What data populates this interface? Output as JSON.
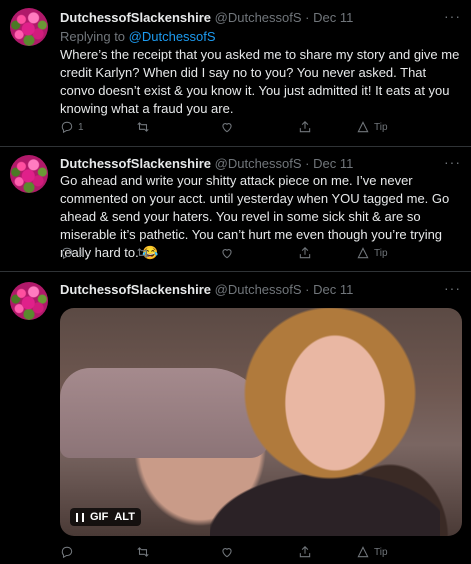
{
  "tweets": [
    {
      "name": "DutchessofSlackenshire",
      "handle": "@DutchessofS",
      "separator": "·",
      "date": "Dec 11",
      "reply_prefix": "Replying to",
      "reply_to": "@DutchessofS",
      "text": "Where’s the receipt that you asked me to share my story and give me credit Karlyn?  When did I say no to you?  You never asked.  That convo doesn’t exist & you know it.  You just admitted it!  It eats at you knowing what a fraud you are.",
      "reply_count": "1",
      "tip_label": "Tip"
    },
    {
      "name": "DutchessofSlackenshire",
      "handle": "@DutchessofS",
      "separator": "·",
      "date": "Dec 11",
      "text": "Go ahead and write your shitty attack piece on me.  I’ve never commented on your acct. until yesterday when YOU tagged me.  Go ahead & send your haters. You revel in some sick shit & are so miserable it’s pathetic.  You can’t hurt me even though you’re trying really hard to. 😂",
      "reply_count": "1",
      "tip_label": "Tip"
    },
    {
      "name": "DutchessofSlackenshire",
      "handle": "@DutchessofS",
      "separator": "·",
      "date": "Dec 11",
      "media": {
        "gif_label": "GIF",
        "alt_label": "ALT"
      },
      "tip_label": "Tip"
    }
  ],
  "more_label": "···",
  "icons": [
    "reply-icon",
    "retweet-icon",
    "like-icon",
    "share-icon",
    "tip-icon",
    "pause-icon"
  ],
  "colors": {
    "link": "#1d9bf0",
    "muted": "#71767b",
    "text": "#e7e9ea",
    "background": "#000000"
  }
}
